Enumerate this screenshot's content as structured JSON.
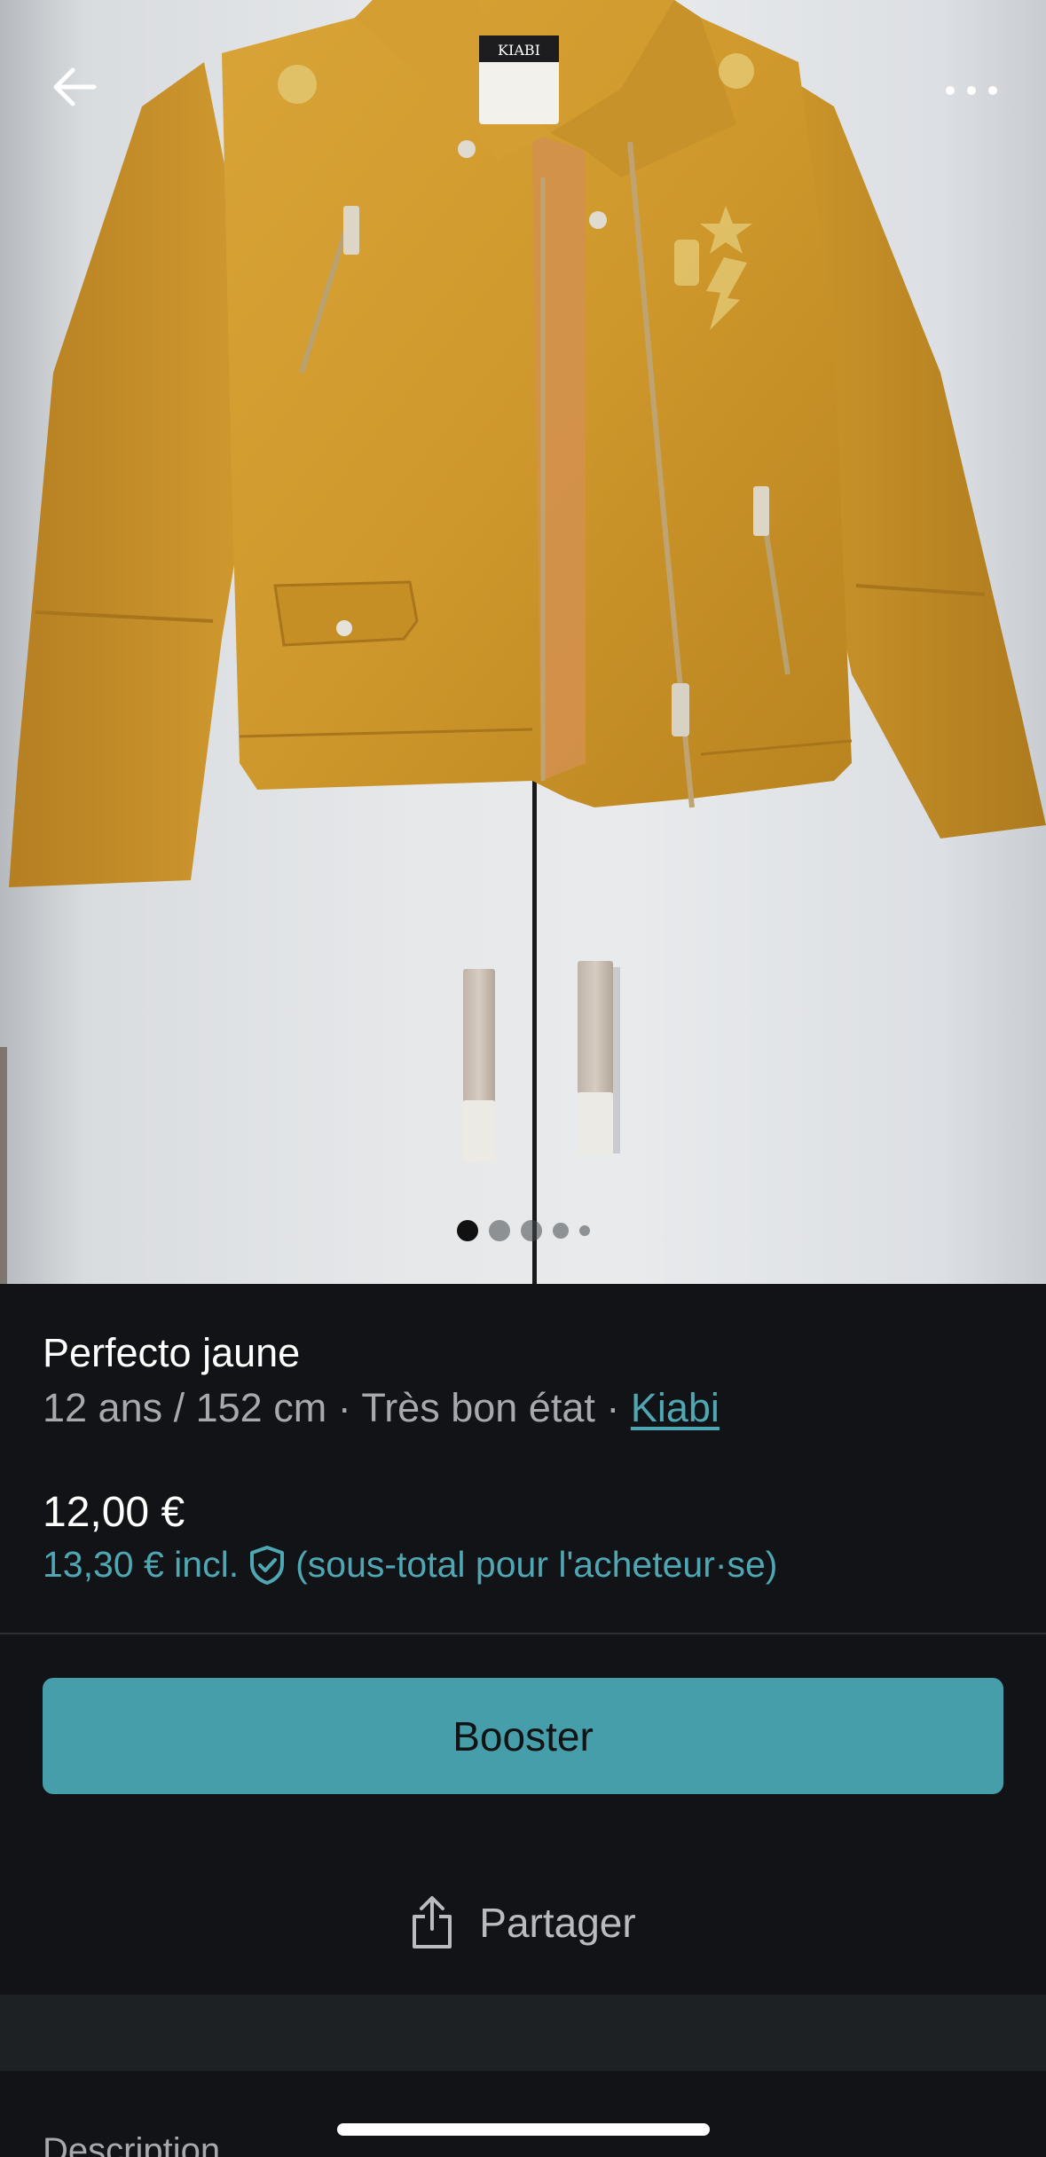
{
  "navigation": {
    "back_icon": "arrow-left-icon",
    "more_icon": "more-horizontal-icon"
  },
  "gallery": {
    "photo_count": 5,
    "active_index": 0,
    "label_tag_text": "KIABI"
  },
  "item": {
    "title": "Perfecto jaune",
    "size": "12 ans / 152 cm",
    "separator": " · ",
    "condition": "Très bon état",
    "brand": "Kiabi",
    "price": "12,00 €",
    "price_incl": "13,30 € incl.",
    "price_incl_note": "(sous-total pour l'acheteur·se)",
    "protection_icon": "shield-check-icon"
  },
  "actions": {
    "booster_label": "Booster",
    "share_label": "Partager",
    "share_icon": "share-upload-icon"
  },
  "sections": {
    "description_label": "Description"
  },
  "colors": {
    "background": "#121316",
    "accent": "#459ea9",
    "accent_text": "#4fa7b3",
    "muted_text": "#a7a9ad",
    "jacket": "#d19a2c"
  }
}
